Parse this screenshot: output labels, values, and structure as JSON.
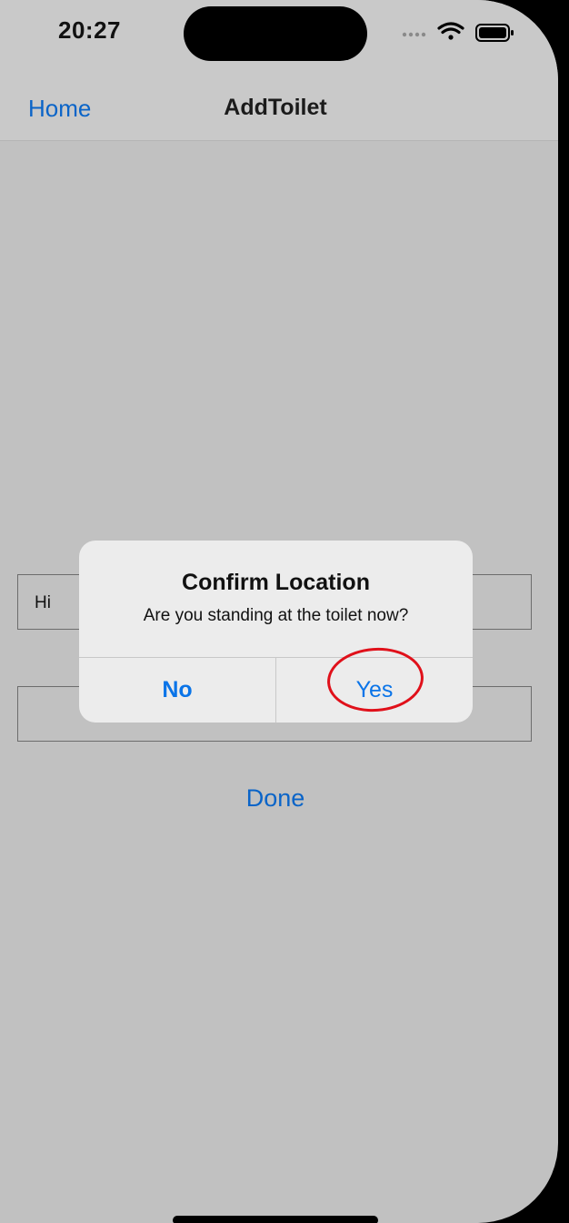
{
  "status_bar": {
    "time": "20:27",
    "icons": [
      "cellular-dots-icon",
      "wifi-icon",
      "battery-icon"
    ]
  },
  "nav": {
    "back_label": "Home",
    "title": "AddToilet"
  },
  "form": {
    "field_1_value": "Hi",
    "field_2_value": "",
    "done_label": "Done"
  },
  "alert": {
    "title": "Confirm Location",
    "message": "Are you standing at the toilet now?",
    "no_label": "No",
    "yes_label": "Yes"
  },
  "colors": {
    "accent": "#0a64c8",
    "alert_button": "#0a74e8",
    "annotation": "#e0101a"
  }
}
